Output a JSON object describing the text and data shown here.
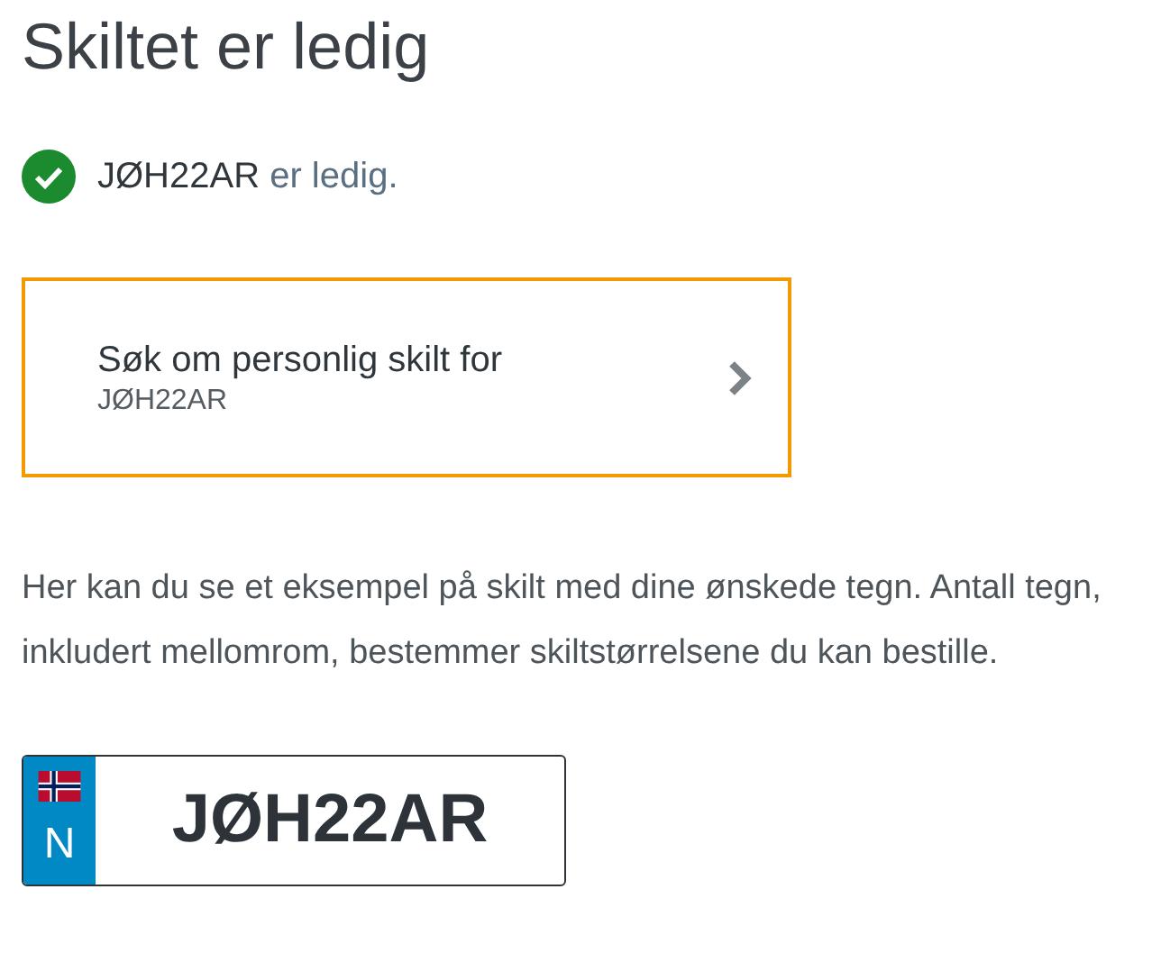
{
  "heading": "Skiltet er ledig",
  "status": {
    "kind": "available",
    "plate": "JØH22AR",
    "text": "er ledig."
  },
  "apply_card": {
    "title": "Søk om personlig skilt for",
    "plate": "JØH22AR"
  },
  "description": "Her kan du se et eksempel på skilt med dine ønskede tegn. Antall tegn, inkludert mellomrom, bestemmer skiltstørrelsene du kan bestille.",
  "plate_preview": {
    "country": "N",
    "text": "JØH22AR"
  }
}
